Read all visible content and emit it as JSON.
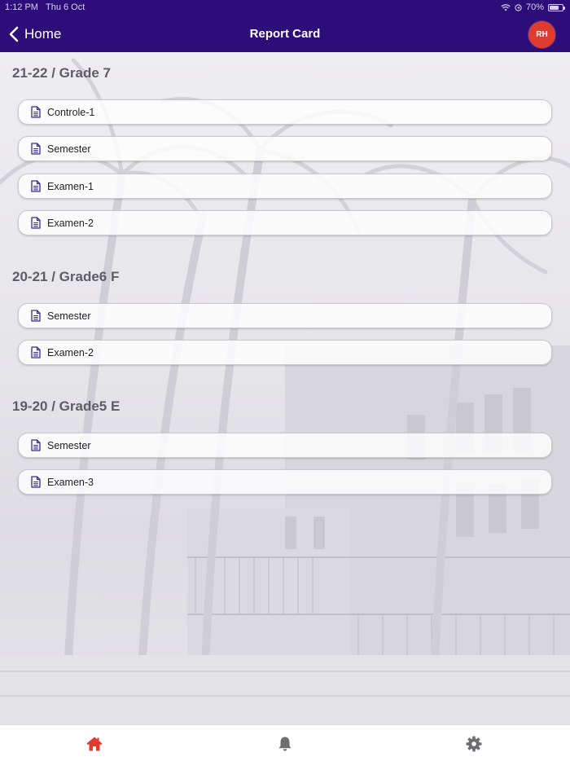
{
  "status_bar": {
    "time": "1:12 PM",
    "date": "Thu 6 Oct",
    "battery": "70%"
  },
  "header": {
    "back_label": "Home",
    "title": "Report Card",
    "avatar_initials": "RH"
  },
  "sections": [
    {
      "title": "21-22 / Grade 7",
      "items": [
        "Controle-1",
        "Semester",
        "Examen-1",
        "Examen-2"
      ]
    },
    {
      "title": "20-21 / Grade6 F",
      "items": [
        "Semester",
        "Examen-2"
      ]
    },
    {
      "title": "19-20 / Grade5 E",
      "items": [
        "Semester",
        "Examen-3"
      ]
    }
  ],
  "tabs": [
    {
      "name": "home",
      "icon": "home-icon",
      "active": true
    },
    {
      "name": "notifications",
      "icon": "bell-icon",
      "active": false
    },
    {
      "name": "settings",
      "icon": "gear-icon",
      "active": false
    }
  ],
  "colors": {
    "header": "#2c0d7a",
    "accent": "#e03b2f",
    "doc_icon": "#3a2a8a",
    "inactive_tab": "#6e6e72"
  }
}
